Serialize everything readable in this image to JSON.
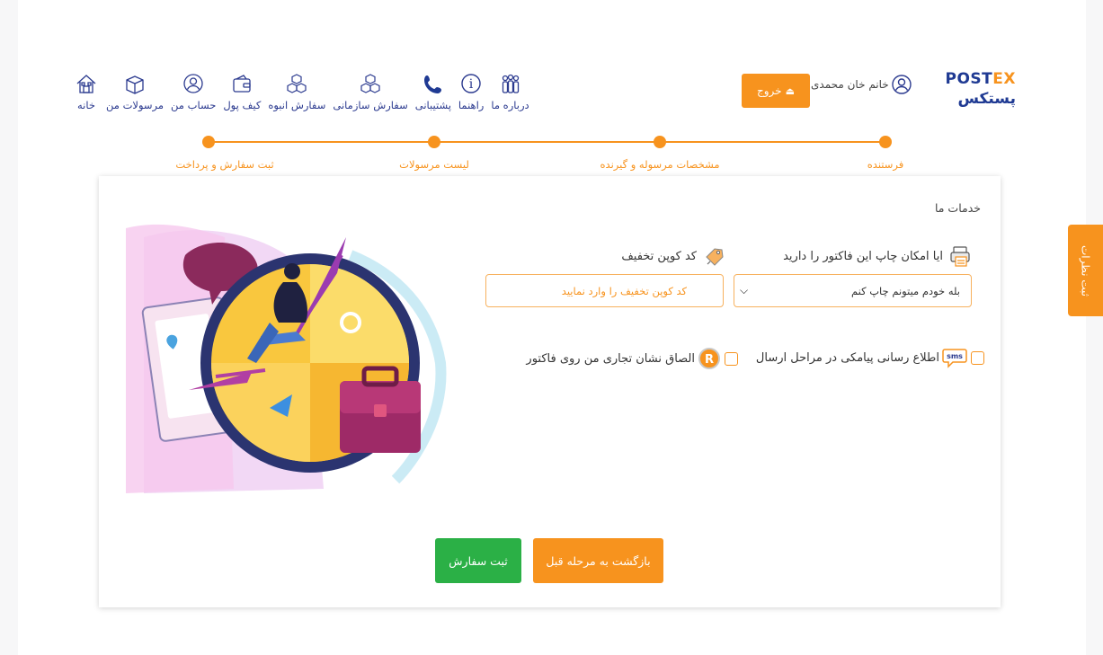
{
  "brand": {
    "logo_en_a": "POST",
    "logo_en_b": "EX",
    "logo_fa": "پستکس"
  },
  "header": {
    "user_name": "خانم خان محمدی",
    "logout_label": "خروج",
    "nav": [
      {
        "label": "درباره ما",
        "icon": "about-icon"
      },
      {
        "label": "راهنما",
        "icon": "info-icon"
      },
      {
        "label": "پشتیبانی",
        "icon": "phone-icon"
      },
      {
        "label": "سفارش سازمانی",
        "icon": "boxes-icon"
      },
      {
        "label": "سفارش انبوه",
        "icon": "boxes-stack-icon"
      },
      {
        "label": "کیف پول",
        "icon": "wallet-icon"
      },
      {
        "label": "حساب من",
        "icon": "user-icon"
      },
      {
        "label": "مرسولات من",
        "icon": "package-icon"
      },
      {
        "label": "خانه",
        "icon": "home-icon"
      }
    ]
  },
  "stepper": {
    "steps": [
      {
        "label": "فرستنده"
      },
      {
        "label": "مشخصات مرسوله و گیرنده"
      },
      {
        "label": "لیست مرسولات"
      },
      {
        "label": "ثبت سفارش و پرداخت"
      }
    ]
  },
  "services": {
    "title": "خدمات ما",
    "print_label": "ایا امکان چاپ این فاکتور را دارید",
    "print_selected": "بله خودم میتونم چاپ کنم",
    "coupon_label": "کد کوپن تخفیف",
    "coupon_placeholder": "کد کوپن تخفیف را وارد نمایید",
    "sms_label": "اطلاع رسانی پیامکی در مراحل ارسال",
    "sms_icon_text": "sms",
    "brand_label": "الصاق نشان تجاری من روی فاکتور",
    "brand_icon_text": "R"
  },
  "actions": {
    "back_label": "بازگشت به مرحله قبل",
    "submit_label": "ثبت سفارش"
  },
  "feedback_label": "ثبت نظرات",
  "colors": {
    "accent": "#f7931e",
    "brand_blue": "#1f3a93",
    "success": "#2bb046"
  }
}
